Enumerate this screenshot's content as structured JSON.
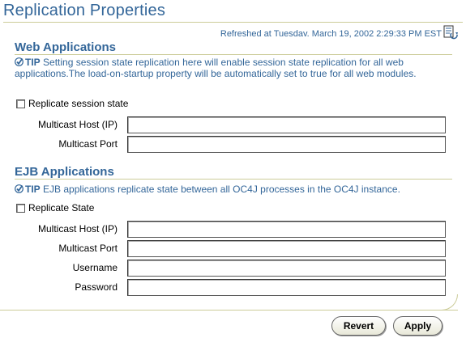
{
  "page": {
    "title": "Replication Properties"
  },
  "refresh": {
    "text": "Refreshed at Tuesdav. March 19, 2002 2:29:33 PM EST"
  },
  "web": {
    "title": "Web Applications",
    "tip_label": "TIP",
    "tip_text": "Setting session state replication here will enable session state replication for all web applications.The load-on-startup property will be automatically set to true for all web modules.",
    "checkbox_label": "Replicate session state",
    "checkbox_checked": false,
    "host_label": "Multicast Host (IP)",
    "host_value": "",
    "port_label": "Multicast Port",
    "port_value": ""
  },
  "ejb": {
    "title": "EJB Applications",
    "tip_label": "TIP",
    "tip_text": "EJB applications replicate state between all OC4J processes in the OC4J instance.",
    "checkbox_label": "Replicate State",
    "checkbox_checked": false,
    "host_label": "Multicast Host (IP)",
    "host_value": "",
    "port_label": "Multicast Port",
    "port_value": "",
    "username_label": "Username",
    "username_value": "",
    "password_label": "Password",
    "password_value": ""
  },
  "buttons": {
    "revert": "Revert",
    "apply": "Apply"
  },
  "colors": {
    "heading": "#336699",
    "rule": "#cccc99"
  },
  "icons": {
    "tip": "check-icon",
    "refresh": "refresh-icon"
  }
}
